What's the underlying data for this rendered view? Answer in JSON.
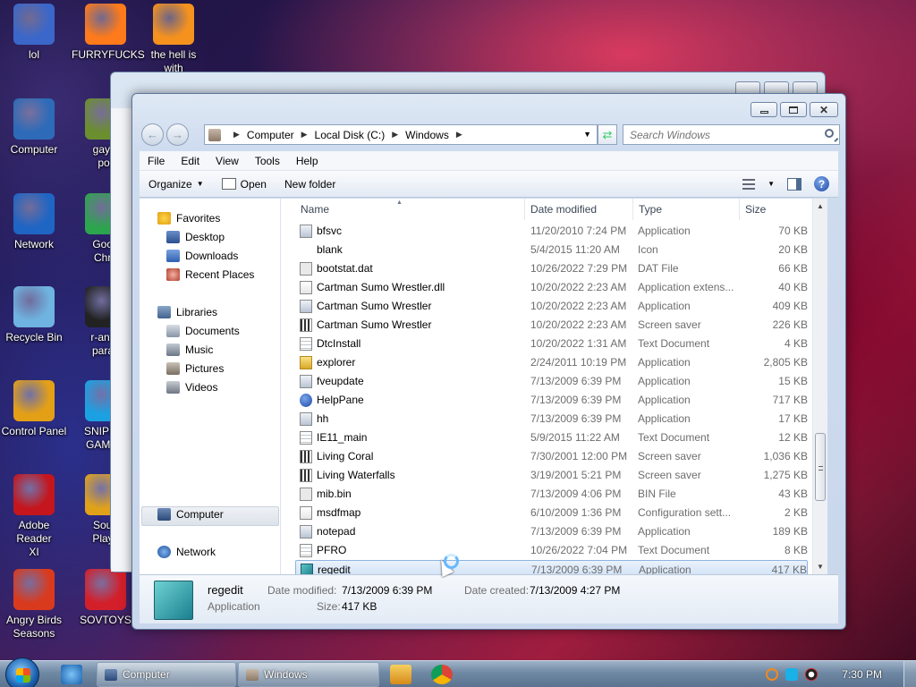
{
  "desktop": {
    "icons": [
      {
        "label": "lol",
        "icon": "shield-icon",
        "color": "#3a67c9"
      },
      {
        "label": "FURRYFUCKS",
        "icon": "firefox-icon",
        "color": "#ff7a1a"
      },
      {
        "label": "the hell is\nwith",
        "icon": "uc-browser-icon",
        "color": "#f5921e"
      },
      {
        "label": "Computer",
        "icon": "computer-icon",
        "color": "#2d6bb8"
      },
      {
        "label": "gay fi\npor",
        "icon": "app-icon",
        "color": "#6b8e2e"
      },
      {
        "label": "Network",
        "icon": "network-icon",
        "color": "#1f65c4"
      },
      {
        "label": "Goog\nChro",
        "icon": "chrome-icon",
        "color": "#2da44e"
      },
      {
        "label": "Recycle Bin",
        "icon": "recycle-bin-icon",
        "color": "#6fb3e0"
      },
      {
        "label": "r-antiv\nparac",
        "icon": "app-icon",
        "color": "#222222"
      },
      {
        "label": "Control Panel",
        "icon": "control-panel-icon",
        "color": "#e3a017"
      },
      {
        "label": "SNIPED!\nGAMER",
        "icon": "skype-icon",
        "color": "#1ba1e2"
      },
      {
        "label": "Adobe Reader\nXI",
        "icon": "adobe-reader-icon",
        "color": "#c4161c"
      },
      {
        "label": "Soup\nPlays",
        "icon": "app-icon",
        "color": "#e1a21a"
      },
      {
        "label": "Angry Birds\nSeasons",
        "icon": "angry-birds-icon",
        "color": "#d93a1e"
      },
      {
        "label": "SOVTOYS",
        "icon": "app-icon",
        "color": "#d31f2a"
      }
    ]
  },
  "window": {
    "address": {
      "crumbs": [
        "Computer",
        "Local Disk (C:)",
        "Windows"
      ]
    },
    "search_placeholder": "Search Windows",
    "menu": [
      "File",
      "Edit",
      "View",
      "Tools",
      "Help"
    ],
    "toolbar": {
      "organize": "Organize",
      "open": "Open",
      "new_folder": "New folder"
    },
    "nav": {
      "favorites": "Favorites",
      "desktop": "Desktop",
      "downloads": "Downloads",
      "recent_places": "Recent Places",
      "libraries": "Libraries",
      "documents": "Documents",
      "music": "Music",
      "pictures": "Pictures",
      "videos": "Videos",
      "computer": "Computer",
      "network": "Network"
    },
    "columns": {
      "name": "Name",
      "date": "Date modified",
      "type": "Type",
      "size": "Size"
    },
    "files": [
      {
        "name": "bfsvc",
        "date": "11/20/2010 7:24 PM",
        "type": "Application",
        "size": "70 KB",
        "icon": "app"
      },
      {
        "name": "blank",
        "date": "5/4/2015 11:20 AM",
        "type": "Icon",
        "size": "20 KB",
        "icon": "blank"
      },
      {
        "name": "bootstat.dat",
        "date": "10/26/2022 7:29 PM",
        "type": "DAT File",
        "size": "66 KB",
        "icon": "dat"
      },
      {
        "name": "Cartman Sumo Wrestler.dll",
        "date": "10/20/2022 2:23 AM",
        "type": "Application extens...",
        "size": "40 KB",
        "icon": "dll"
      },
      {
        "name": "Cartman Sumo Wrestler",
        "date": "10/20/2022 2:23 AM",
        "type": "Application",
        "size": "409 KB",
        "icon": "app"
      },
      {
        "name": "Cartman Sumo Wrestler",
        "date": "10/20/2022 2:23 AM",
        "type": "Screen saver",
        "size": "226 KB",
        "icon": "scr"
      },
      {
        "name": "DtcInstall",
        "date": "10/20/2022 1:31 AM",
        "type": "Text Document",
        "size": "4 KB",
        "icon": "txt"
      },
      {
        "name": "explorer",
        "date": "2/24/2011 10:19 PM",
        "type": "Application",
        "size": "2,805 KB",
        "icon": "folder"
      },
      {
        "name": "fveupdate",
        "date": "7/13/2009 6:39 PM",
        "type": "Application",
        "size": "15 KB",
        "icon": "app"
      },
      {
        "name": "HelpPane",
        "date": "7/13/2009 6:39 PM",
        "type": "Application",
        "size": "717 KB",
        "icon": "help"
      },
      {
        "name": "hh",
        "date": "7/13/2009 6:39 PM",
        "type": "Application",
        "size": "17 KB",
        "icon": "app"
      },
      {
        "name": "IE11_main",
        "date": "5/9/2015 11:22 AM",
        "type": "Text Document",
        "size": "12 KB",
        "icon": "txt"
      },
      {
        "name": "Living Coral",
        "date": "7/30/2001 12:00 PM",
        "type": "Screen saver",
        "size": "1,036 KB",
        "icon": "scr"
      },
      {
        "name": "Living Waterfalls",
        "date": "3/19/2001 5:21 PM",
        "type": "Screen saver",
        "size": "1,275 KB",
        "icon": "scr"
      },
      {
        "name": "mib.bin",
        "date": "7/13/2009 4:06 PM",
        "type": "BIN File",
        "size": "43 KB",
        "icon": "dat"
      },
      {
        "name": "msdfmap",
        "date": "6/10/2009 1:36 PM",
        "type": "Configuration sett...",
        "size": "2 KB",
        "icon": "dll"
      },
      {
        "name": "notepad",
        "date": "7/13/2009 6:39 PM",
        "type": "Application",
        "size": "189 KB",
        "icon": "app"
      },
      {
        "name": "PFRO",
        "date": "10/26/2022 7:04 PM",
        "type": "Text Document",
        "size": "8 KB",
        "icon": "txt"
      },
      {
        "name": "regedit",
        "date": "7/13/2009 6:39 PM",
        "type": "Application",
        "size": "417 KB",
        "icon": "reg",
        "selected": true
      }
    ],
    "details": {
      "name": "regedit",
      "type": "Application",
      "date_modified_label": "Date modified:",
      "date_modified": "7/13/2009 6:39 PM",
      "date_created_label": "Date created:",
      "date_created": "7/13/2009 4:27 PM",
      "size_label": "Size:",
      "size": "417 KB"
    }
  },
  "taskbar": {
    "tasks": [
      {
        "label": "Computer",
        "icon": "computer-icon"
      },
      {
        "label": "Windows",
        "icon": "folder-icon"
      }
    ],
    "clock": "7:30 PM"
  }
}
